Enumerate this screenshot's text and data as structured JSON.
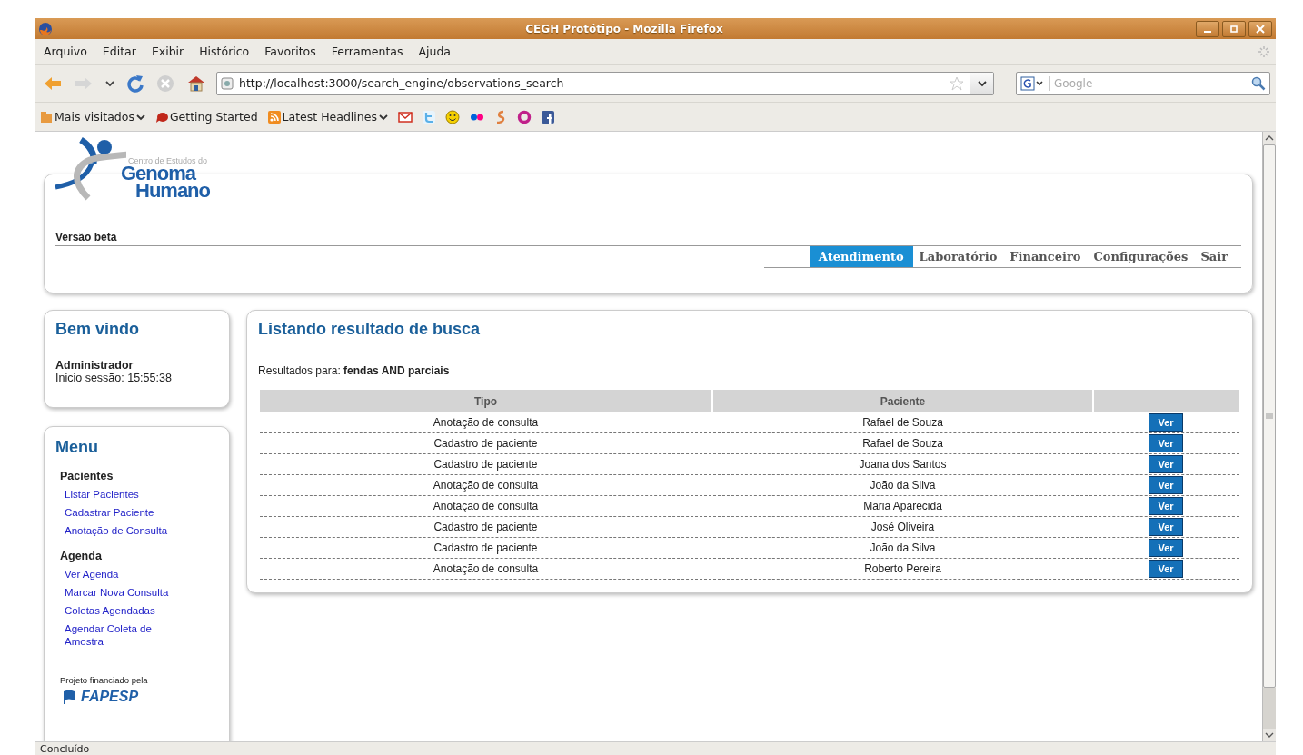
{
  "window": {
    "title": "CEGH Protótipo - Mozilla Firefox"
  },
  "menu_bar": [
    "Arquivo",
    "Editar",
    "Exibir",
    "Histórico",
    "Favoritos",
    "Ferramentas",
    "Ajuda"
  ],
  "nav_bar": {
    "url": "http://localhost:3000/search_engine/observations_search",
    "search_placeholder": "Google"
  },
  "bookmarks": [
    {
      "label": "Mais visitados",
      "dropdown": true
    },
    {
      "label": "Getting Started",
      "dropdown": false
    },
    {
      "label": "Latest Headlines",
      "dropdown": true
    }
  ],
  "header": {
    "logo": {
      "subtitle": "Centro de Estudos do",
      "line1": "Genoma",
      "line2": "Humano"
    },
    "version": "Versão beta",
    "tabs": [
      {
        "label": "Atendimento",
        "selected": true
      },
      {
        "label": "Laboratório",
        "selected": false
      },
      {
        "label": "Financeiro",
        "selected": false
      },
      {
        "label": "Configurações",
        "selected": false
      },
      {
        "label": "Sair",
        "selected": false
      }
    ]
  },
  "welcome": {
    "title": "Bem vindo",
    "user": "Administrador",
    "session": "Inicio sessão: 15:55:38"
  },
  "menu": {
    "title": "Menu",
    "sections": [
      {
        "heading": "Pacientes",
        "links": [
          "Listar Pacientes",
          "Cadastrar Paciente",
          "Anotação de Consulta"
        ]
      },
      {
        "heading": "Agenda",
        "links": [
          "Ver Agenda",
          "Marcar Nova Consulta",
          "Coletas Agendadas",
          "Agendar Coleta de Amostra"
        ]
      }
    ],
    "funding": {
      "text": "Projeto financiado pela",
      "logo": "FAPESP"
    }
  },
  "results": {
    "title": "Listando resultado de busca",
    "query": "Resultados para: **fendas AND parciais**",
    "columns": [
      "Tipo",
      "Paciente"
    ],
    "rows": [
      {
        "tipo": "Anotação de consulta",
        "paciente": "Rafael de Souza",
        "action": "Ver"
      },
      {
        "tipo": "Cadastro de paciente",
        "paciente": "Rafael de Souza",
        "action": "Ver"
      },
      {
        "tipo": "Cadastro de paciente",
        "paciente": "Joana dos Santos",
        "action": "Ver"
      },
      {
        "tipo": "Anotação de consulta",
        "paciente": "João da Silva",
        "action": "Ver"
      },
      {
        "tipo": "Anotação de consulta",
        "paciente": "Maria Aparecida",
        "action": "Ver"
      },
      {
        "tipo": "Cadastro de paciente",
        "paciente": "José Oliveira",
        "action": "Ver"
      },
      {
        "tipo": "Cadastro de paciente",
        "paciente": "João da Silva",
        "action": "Ver"
      },
      {
        "tipo": "Anotação de consulta",
        "paciente": "Roberto Pereira",
        "action": "Ver"
      }
    ]
  },
  "status_bar": {
    "text": "Concluído"
  }
}
